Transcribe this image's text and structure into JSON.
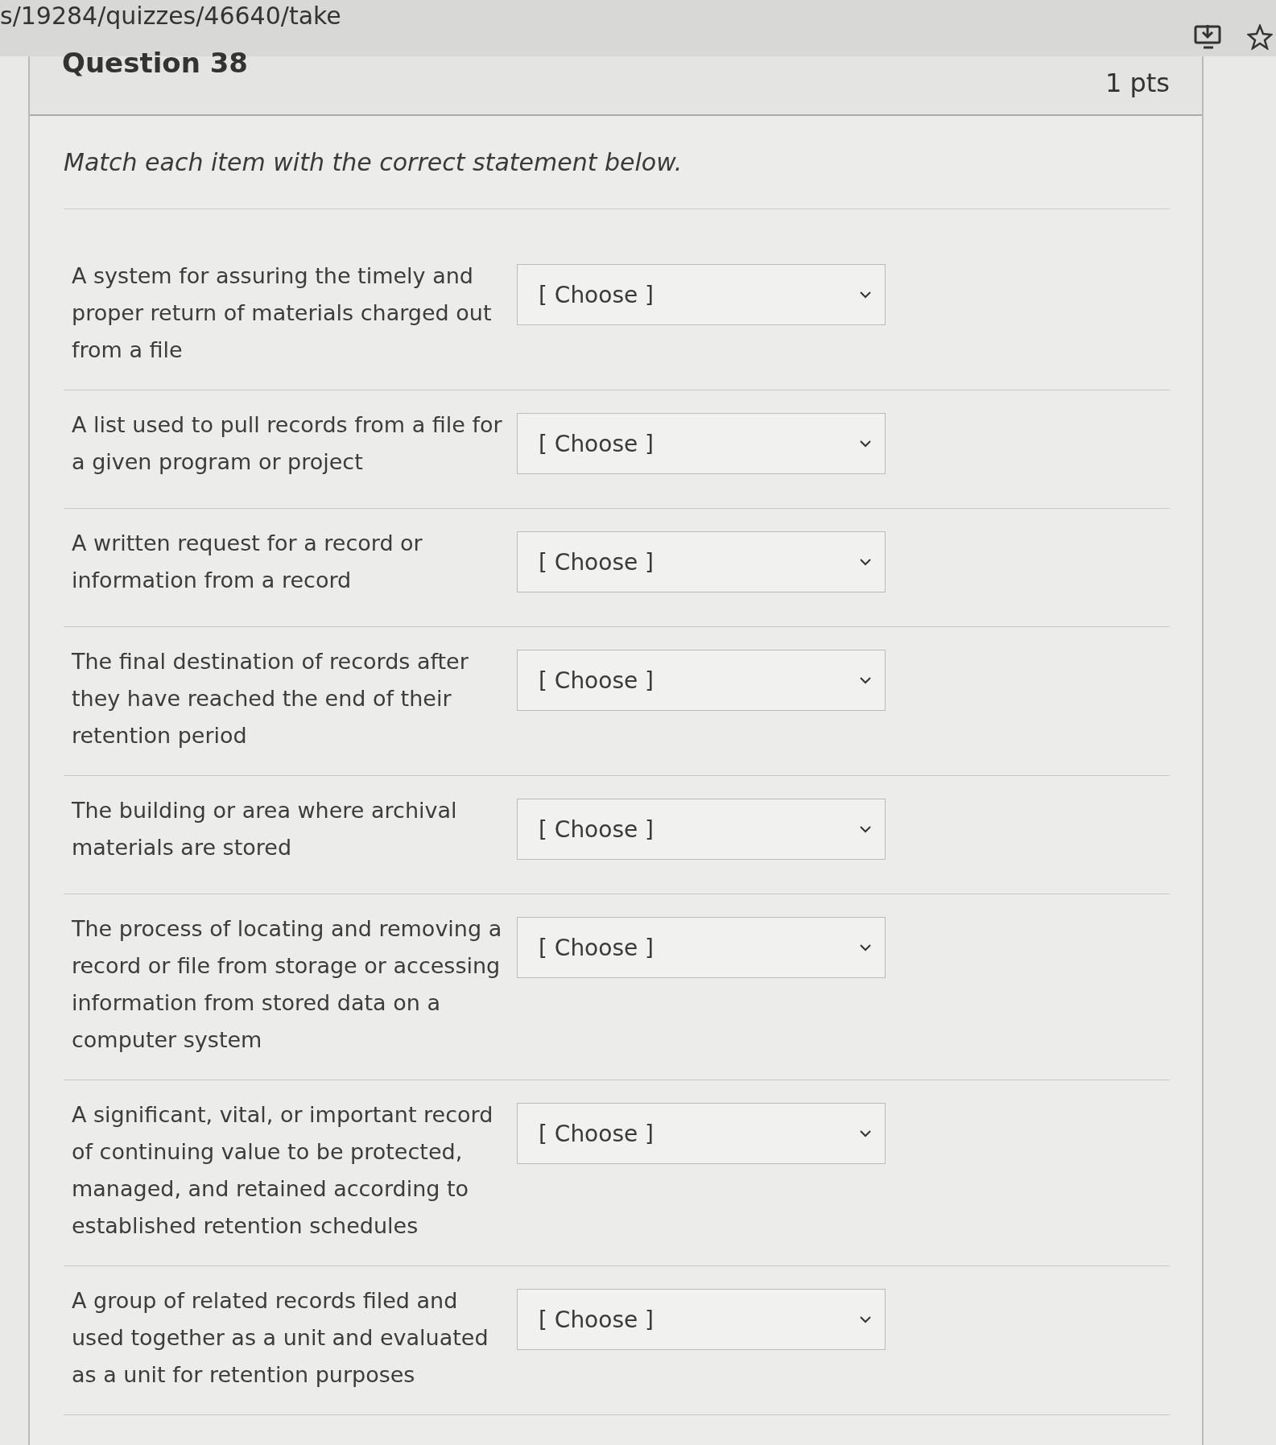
{
  "address_bar": {
    "url": "s/19284/quizzes/46640/take"
  },
  "question": {
    "title": "Question 38",
    "points": "1 pts",
    "prompt": "Match each item with the correct statement below.",
    "items": [
      {
        "text": "A system for assuring the timely and proper return of materials charged out from a file",
        "select": "[ Choose ]"
      },
      {
        "text": "A list used to pull records from a file for a given program or project",
        "select": "[ Choose ]"
      },
      {
        "text": "A written request for a record or information from a record",
        "select": "[ Choose ]"
      },
      {
        "text": "The final destination of records after they have reached the end of their retention period",
        "select": "[ Choose ]"
      },
      {
        "text": "The building or area where archival materials are stored",
        "select": "[ Choose ]"
      },
      {
        "text": "The process of locating and removing a record or file from storage or accessing information from stored data on a computer system",
        "select": "[ Choose ]"
      },
      {
        "text": "A significant, vital, or important record of continuing value to be protected, managed, and retained according to established retention schedules",
        "select": "[ Choose ]"
      },
      {
        "text": "A group of related records filed and used together as a unit and evaluated as a unit for retention purposes",
        "select": "[ Choose ]"
      }
    ]
  }
}
